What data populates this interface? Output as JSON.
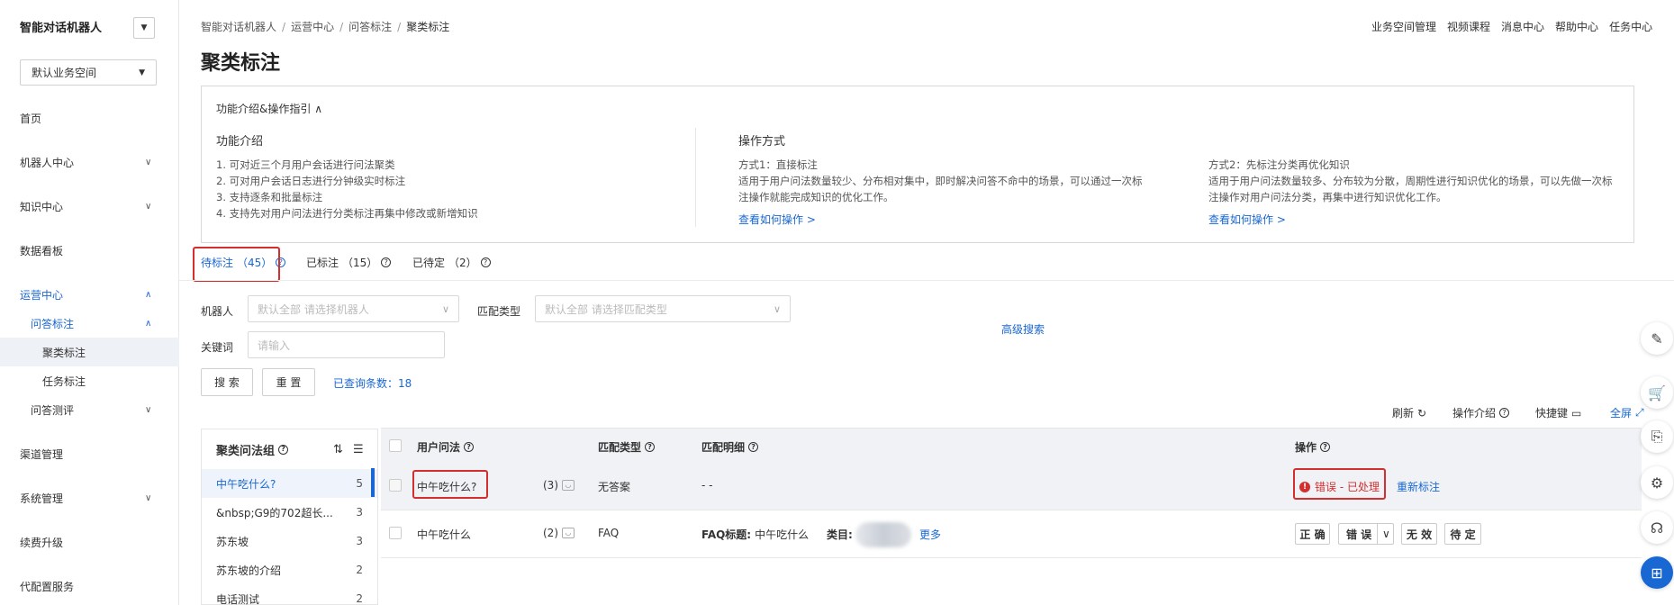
{
  "sidebar": {
    "brand": "智能对话机器人",
    "brand_toggle": "▼",
    "workspace": "默认业务空间",
    "items": {
      "home": "首页",
      "robot_center": "机器人中心",
      "knowledge_center": "知识中心",
      "dashboard": "数据看板",
      "ops_center": "运营中心",
      "qa_label": "问答标注",
      "cluster_label": "聚类标注",
      "task_label": "任务标注",
      "qa_test": "问答测评",
      "channel": "渠道管理",
      "system": "系统管理",
      "renew": "续费升级",
      "service": "代配置服务"
    }
  },
  "header": {
    "breadcrumb": [
      "智能对话机器人",
      "运营中心",
      "问答标注",
      "聚类标注"
    ],
    "links": [
      "业务空间管理",
      "视频课程",
      "消息中心",
      "帮助中心",
      "任务中心"
    ],
    "title": "聚类标注"
  },
  "intro": {
    "toggle": "功能介绍&操作指引",
    "func_title": "功能介绍",
    "func_list": [
      "1. 可对近三个月用户会话进行问法聚类",
      "2. 可对用户会话日志进行分钟级实时标注",
      "3. 支持逐条和批量标注",
      "4. 支持先对用户问法进行分类标注再集中修改或新增知识"
    ],
    "op_title": "操作方式",
    "method1_title": "方式1：直接标注",
    "method1_desc": [
      "适用于用户问法数量较少、分布相对集中，即时解决问答不命中的场景，可以通过一次标",
      "注操作就能完成知识的优化工作。"
    ],
    "method1_link": "查看如何操作 >",
    "method2_title": "方式2：先标注分类再优化知识",
    "method2_desc": [
      "适用于用户问法数量较多、分布较为分散，周期性进行知识优化的场景，可以先做一次标",
      "注操作对用户问法分类，再集中进行知识优化工作。"
    ],
    "method2_link": "查看如何操作 >"
  },
  "tabs": [
    {
      "label": "待标注",
      "count": "（45）"
    },
    {
      "label": "已标注",
      "count": "（15）"
    },
    {
      "label": "已待定",
      "count": "（2）"
    }
  ],
  "filters": {
    "robot_label": "机器人",
    "robot_placeholder": "默认全部 请选择机器人",
    "match_label": "匹配类型",
    "match_placeholder": "默认全部 请选择匹配类型",
    "keyword_label": "关键词",
    "keyword_placeholder": "请输入",
    "advanced": "高级搜索",
    "search_btn": "搜 索",
    "reset_btn": "重 置",
    "count_text": "已查询条数：18"
  },
  "toolbar": {
    "refresh": "刷新",
    "guide": "操作介绍",
    "shortcut": "快捷键",
    "fullscreen": "全屏"
  },
  "groups": {
    "title": "聚类问法组",
    "items": [
      {
        "name": "中午吃什么?",
        "count": "5"
      },
      {
        "name": "&nbsp;G9的702超长...",
        "count": "3"
      },
      {
        "name": "苏东坡",
        "count": "3"
      },
      {
        "name": "苏东坡的介绍",
        "count": "2"
      },
      {
        "name": "电话测试",
        "count": "2"
      }
    ]
  },
  "table": {
    "headers": {
      "query": "用户问法",
      "match_type": "匹配类型",
      "match_detail": "匹配明细",
      "action": "操作"
    },
    "rows": [
      {
        "query": "中午吃什么?",
        "count": "(3)",
        "match_type": "无答案",
        "detail": "- -",
        "status": "错误 - 已处理",
        "relabel": "重新标注"
      },
      {
        "query": "中午吃什么",
        "count": "(2)",
        "match_type": "FAQ",
        "detail_label": "FAQ标题:",
        "detail_value": "中午吃什么",
        "category_label": "类目:",
        "category_value": "",
        "more": "更多",
        "btn_correct": "正 确",
        "btn_wrong": "错 误",
        "btn_wrong_caret": "∨",
        "btn_invalid": "无 效",
        "btn_pending": "待 定"
      }
    ]
  }
}
